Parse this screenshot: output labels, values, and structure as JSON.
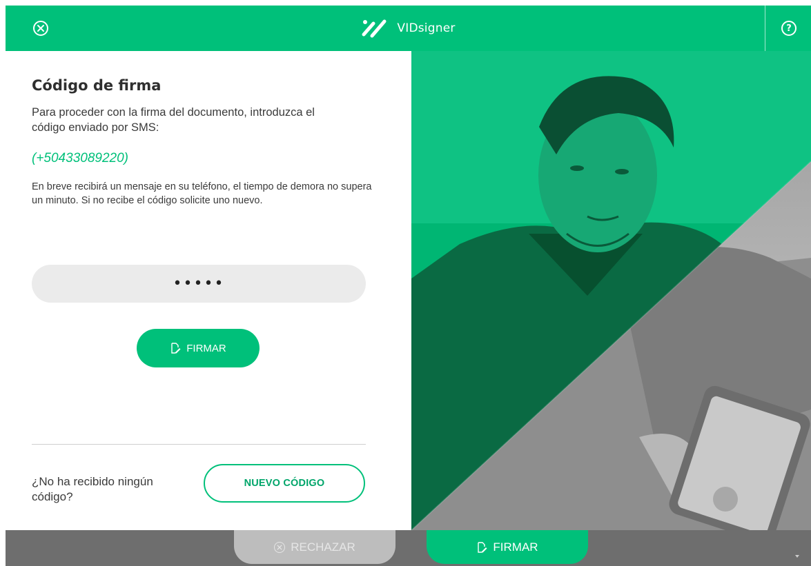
{
  "header": {
    "brand": "VIDsigner",
    "close_icon": "close-circle-icon",
    "help_icon": "help-circle-icon",
    "help_glyph": "?"
  },
  "panel": {
    "title": "Código de firma",
    "intro": "Para proceder con la firma del documento, introduzca el código enviado por SMS:",
    "phone": "(+50433089220)",
    "info": "En breve recibirá un mensaje en su teléfono, el tiempo de demora no supera un minuto. Si no recibe el código solicite uno nuevo.",
    "code_value": "•••••",
    "sign_label": "FIRMAR",
    "no_code_text": "¿No ha recibido ningún código?",
    "new_code_label": "NUEVO CÓDIGO"
  },
  "footer": {
    "reject_label": "RECHAZAR",
    "sign_label": "FIRMAR"
  },
  "colors": {
    "brand_green": "#00c07a",
    "footer_gray": "#6e6e6e",
    "reject_gray": "#bdbdbd",
    "input_bg": "#ebebeb"
  }
}
